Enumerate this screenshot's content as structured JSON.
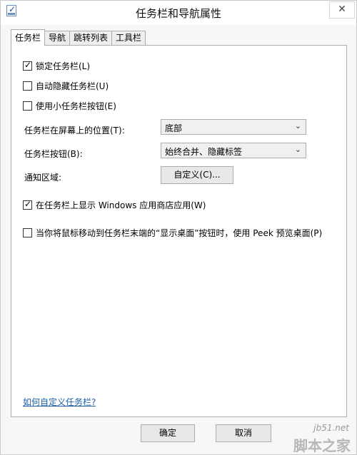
{
  "window": {
    "title": "任务栏和导航属性",
    "close_glyph": "✕"
  },
  "tabs": [
    {
      "label": "任务栏",
      "active": true
    },
    {
      "label": "导航"
    },
    {
      "label": "跳转列表"
    },
    {
      "label": "工具栏"
    }
  ],
  "options": {
    "lock_taskbar": {
      "label": "锁定任务栏(L)",
      "checked": true
    },
    "auto_hide": {
      "label": "自动隐藏任务栏(U)",
      "checked": false
    },
    "small_buttons": {
      "label": "使用小任务栏按钮(E)",
      "checked": false
    },
    "show_store_apps": {
      "label": "在任务栏上显示 Windows 应用商店应用(W)",
      "checked": true
    },
    "peek": {
      "label": "当你将鼠标移动到任务栏末端的“显示桌面”按钮时，使用 Peek 预览桌面(P)",
      "checked": false
    }
  },
  "location": {
    "label": "任务栏在屏幕上的位置(T):",
    "value": "底部"
  },
  "buttons_setting": {
    "label": "任务栏按钮(B):",
    "value": "始终合并、隐藏标签"
  },
  "notification": {
    "label": "通知区域:",
    "button": "自定义(C)..."
  },
  "help_link": "如何自定义任务栏?",
  "footer": {
    "ok": "确定",
    "cancel": "取消"
  },
  "watermark": {
    "url": "jb51.net",
    "name": "脚本之家"
  },
  "icons": {
    "check": "✓",
    "dropdown": "⌄"
  }
}
